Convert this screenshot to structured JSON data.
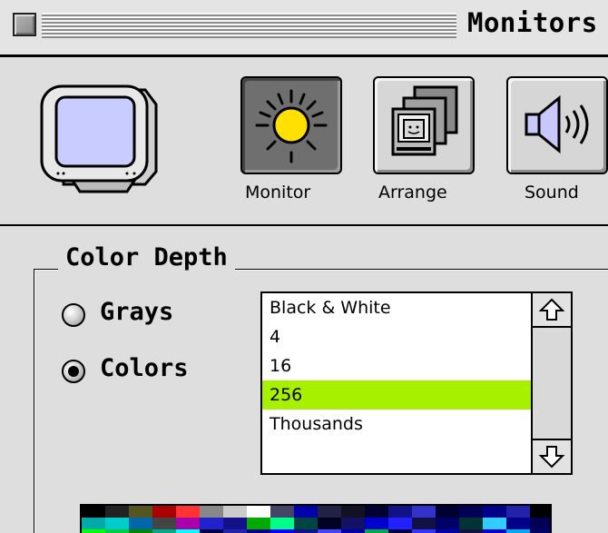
{
  "window": {
    "title": "Monitors"
  },
  "toolbar": {
    "buttons": [
      {
        "label": "Monitor",
        "icon": "sun-icon",
        "selected": true
      },
      {
        "label": "Arrange",
        "icon": "arrange-displays-icon",
        "selected": false
      },
      {
        "label": "Sound",
        "icon": "speaker-icon",
        "selected": false
      }
    ]
  },
  "color_depth": {
    "title": "Color Depth",
    "mode_options": [
      {
        "label": "Grays",
        "checked": false
      },
      {
        "label": "Colors",
        "checked": true
      }
    ],
    "depth_list": {
      "items": [
        "Black & White",
        "4",
        "16",
        "256",
        "Thousands"
      ],
      "selected": "256"
    }
  },
  "colors": {
    "selection_highlight": "#a6f000",
    "window_background": "#dedede"
  }
}
